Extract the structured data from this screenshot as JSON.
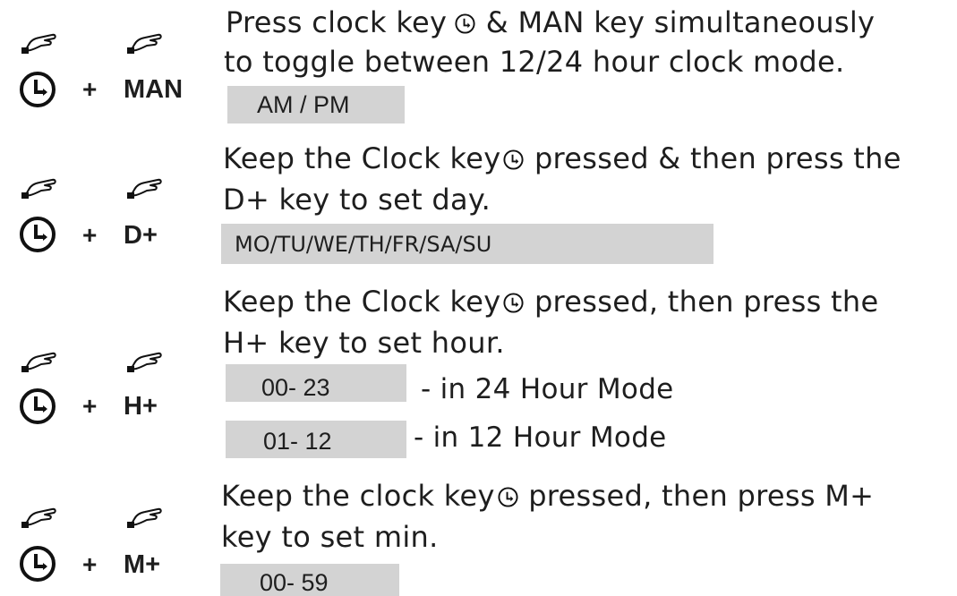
{
  "accent_gray": "#d3d3d3",
  "rows": [
    {
      "key_label": "MAN",
      "plus": "+",
      "line1_before": "Press  clock key",
      "line1_after": " & MAN key simultaneously",
      "line2": "to toggle between 12/24 hour clock mode.",
      "box": "AM / PM"
    },
    {
      "key_label": "D+",
      "plus": "+",
      "line1_before": "Keep the Clock key",
      "line1_after": " pressed & then press the",
      "line2": "D+ key to set day.",
      "box": "MO/TU/WE/TH/FR/SA/SU"
    },
    {
      "key_label": "H+",
      "plus": "+",
      "line1_before": "Keep the Clock key",
      "line1_after": " pressed, then press the",
      "line2": "H+ key to set hour.",
      "box": "00-  23",
      "box_note": "- in 24 Hour Mode",
      "box2": "01-  12",
      "box2_note": "-  in 12 Hour Mode"
    },
    {
      "key_label": "M+",
      "plus": "+",
      "line1_before": "Keep the clock key",
      "line1_after": " pressed, then press M+",
      "line2": "key to set min.",
      "box": "00- 59"
    }
  ]
}
